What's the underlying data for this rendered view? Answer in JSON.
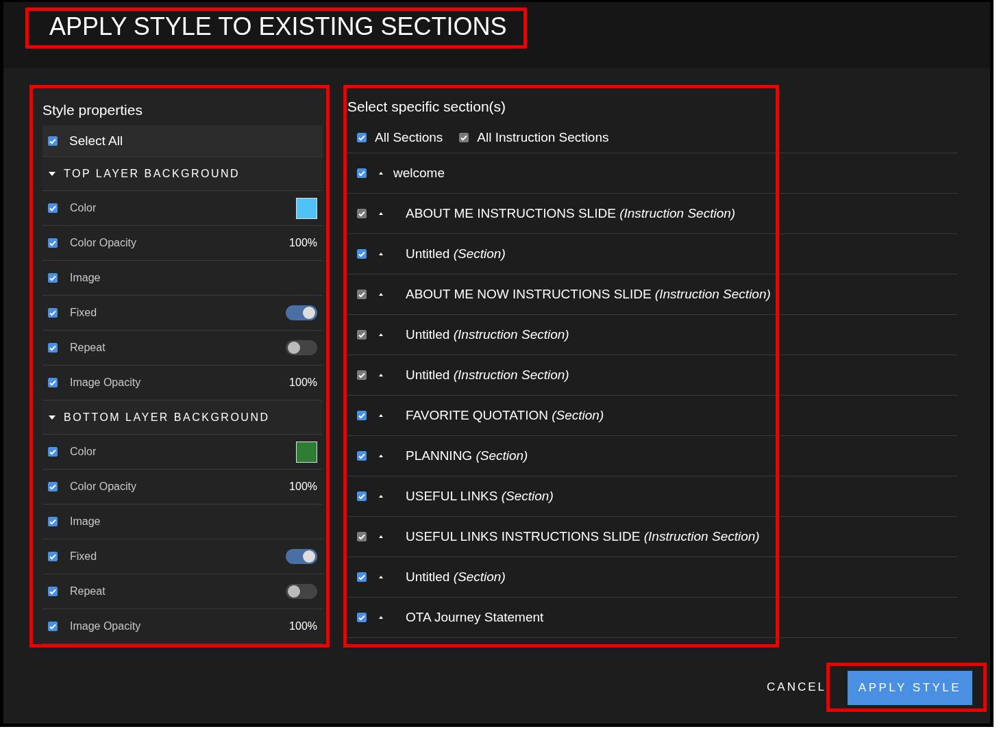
{
  "dialog": {
    "title": "APPLY STYLE TO EXISTING SECTIONS"
  },
  "style_panel": {
    "heading": "Style properties",
    "select_all": {
      "label": "Select All",
      "checked": true
    },
    "groups": [
      {
        "title": "TOP LAYER BACKGROUND",
        "expanded": true,
        "properties": [
          {
            "label": "Color",
            "checked": true,
            "kind": "swatch",
            "color": "#4fc3f7"
          },
          {
            "label": "Color Opacity",
            "checked": true,
            "kind": "value",
            "value": "100%"
          },
          {
            "label": "Image",
            "checked": true,
            "kind": "none"
          },
          {
            "label": "Fixed",
            "checked": true,
            "kind": "toggle",
            "on": true
          },
          {
            "label": "Repeat",
            "checked": true,
            "kind": "toggle",
            "on": false
          },
          {
            "label": "Image Opacity",
            "checked": true,
            "kind": "value",
            "value": "100%"
          }
        ]
      },
      {
        "title": "BOTTOM LAYER BACKGROUND",
        "expanded": true,
        "properties": [
          {
            "label": "Color",
            "checked": true,
            "kind": "swatch",
            "color": "#2e7d32"
          },
          {
            "label": "Color Opacity",
            "checked": true,
            "kind": "value",
            "value": "100%"
          },
          {
            "label": "Image",
            "checked": true,
            "kind": "none"
          },
          {
            "label": "Fixed",
            "checked": true,
            "kind": "toggle",
            "on": true
          },
          {
            "label": "Repeat",
            "checked": true,
            "kind": "toggle",
            "on": false
          },
          {
            "label": "Image Opacity",
            "checked": true,
            "kind": "value",
            "value": "100%"
          }
        ]
      }
    ]
  },
  "sections_panel": {
    "heading": "Select specific section(s)",
    "filters": [
      {
        "label": "All Sections",
        "checked": true,
        "disabled": false
      },
      {
        "label": "All Instruction Sections",
        "checked": true,
        "disabled": true
      }
    ],
    "sections": [
      {
        "name": "welcome",
        "checked": true,
        "disabled": false,
        "children": [
          {
            "name": "ABOUT ME INSTRUCTIONS SLIDE *(Instruction Section)*",
            "checked": true,
            "disabled": true
          },
          {
            "name": "Untitled *(Section)*",
            "checked": true,
            "disabled": false
          },
          {
            "name": "ABOUT ME NOW INSTRUCTIONS SLIDE *(Instruction Section)*",
            "checked": true,
            "disabled": true
          },
          {
            "name": "Untitled *(Instruction Section)*",
            "checked": true,
            "disabled": true
          },
          {
            "name": "Untitled *(Instruction Section)*",
            "checked": true,
            "disabled": true
          },
          {
            "name": "FAVORITE QUOTATION *(Section)*",
            "checked": true,
            "disabled": false
          },
          {
            "name": "PLANNING *(Section)*",
            "checked": true,
            "disabled": false
          },
          {
            "name": "USEFUL LINKS *(Section)*",
            "checked": true,
            "disabled": false
          },
          {
            "name": "USEFUL LINKS INSTRUCTIONS SLIDE *(Instruction Section)*",
            "checked": true,
            "disabled": true
          },
          {
            "name": "Untitled *(Section)*",
            "checked": true,
            "disabled": false
          },
          {
            "name": "OTA Journey Statement",
            "checked": true,
            "disabled": false
          }
        ]
      }
    ]
  },
  "actions": {
    "cancel": "CANCEL",
    "apply": "APPLY STYLE"
  }
}
